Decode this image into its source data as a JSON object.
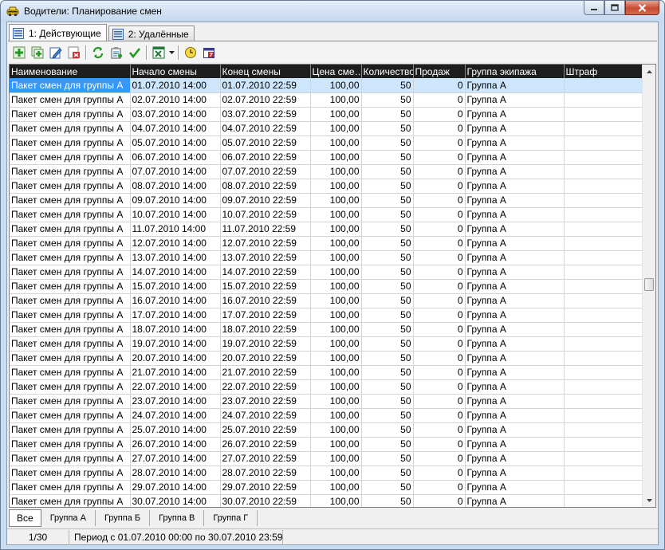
{
  "window": {
    "title": "Водители: Планирование смен"
  },
  "top_tabs": [
    {
      "label": "1: Действующие",
      "active": true
    },
    {
      "label": "2: Удалённые",
      "active": false
    }
  ],
  "toolbar": {
    "buttons": [
      {
        "icon": "add-icon"
      },
      {
        "icon": "add-copy-icon"
      },
      {
        "icon": "edit-icon"
      },
      {
        "icon": "delete-icon"
      },
      {
        "icon": "refresh-icon"
      },
      {
        "icon": "properties-icon"
      },
      {
        "icon": "checkmark-icon"
      },
      {
        "icon": "excel-export-icon"
      },
      {
        "icon": "clock-icon"
      },
      {
        "icon": "calendar-icon"
      }
    ]
  },
  "table": {
    "columns": [
      "Наименование",
      "Начало смены",
      "Конец смены",
      "Цена сме…",
      "Количество",
      "Продаж",
      "Группа экипажа",
      "Штраф"
    ],
    "rows": [
      [
        "Пакет смен для группы А",
        "01.07.2010 14:00",
        "01.07.2010 22:59",
        "100,00",
        "50",
        "0",
        "Группа А",
        ""
      ],
      [
        "Пакет смен для группы А",
        "02.07.2010 14:00",
        "02.07.2010 22:59",
        "100,00",
        "50",
        "0",
        "Группа А",
        ""
      ],
      [
        "Пакет смен для группы А",
        "03.07.2010 14:00",
        "03.07.2010 22:59",
        "100,00",
        "50",
        "0",
        "Группа А",
        ""
      ],
      [
        "Пакет смен для группы А",
        "04.07.2010 14:00",
        "04.07.2010 22:59",
        "100,00",
        "50",
        "0",
        "Группа А",
        ""
      ],
      [
        "Пакет смен для группы А",
        "05.07.2010 14:00",
        "05.07.2010 22:59",
        "100,00",
        "50",
        "0",
        "Группа А",
        ""
      ],
      [
        "Пакет смен для группы А",
        "06.07.2010 14:00",
        "06.07.2010 22:59",
        "100,00",
        "50",
        "0",
        "Группа А",
        ""
      ],
      [
        "Пакет смен для группы А",
        "07.07.2010 14:00",
        "07.07.2010 22:59",
        "100,00",
        "50",
        "0",
        "Группа А",
        ""
      ],
      [
        "Пакет смен для группы А",
        "08.07.2010 14:00",
        "08.07.2010 22:59",
        "100,00",
        "50",
        "0",
        "Группа А",
        ""
      ],
      [
        "Пакет смен для группы А",
        "09.07.2010 14:00",
        "09.07.2010 22:59",
        "100,00",
        "50",
        "0",
        "Группа А",
        ""
      ],
      [
        "Пакет смен для группы А",
        "10.07.2010 14:00",
        "10.07.2010 22:59",
        "100,00",
        "50",
        "0",
        "Группа А",
        ""
      ],
      [
        "Пакет смен для группы А",
        "11.07.2010 14:00",
        "11.07.2010 22:59",
        "100,00",
        "50",
        "0",
        "Группа А",
        ""
      ],
      [
        "Пакет смен для группы А",
        "12.07.2010 14:00",
        "12.07.2010 22:59",
        "100,00",
        "50",
        "0",
        "Группа А",
        ""
      ],
      [
        "Пакет смен для группы А",
        "13.07.2010 14:00",
        "13.07.2010 22:59",
        "100,00",
        "50",
        "0",
        "Группа А",
        ""
      ],
      [
        "Пакет смен для группы А",
        "14.07.2010 14:00",
        "14.07.2010 22:59",
        "100,00",
        "50",
        "0",
        "Группа А",
        ""
      ],
      [
        "Пакет смен для группы А",
        "15.07.2010 14:00",
        "15.07.2010 22:59",
        "100,00",
        "50",
        "0",
        "Группа А",
        ""
      ],
      [
        "Пакет смен для группы А",
        "16.07.2010 14:00",
        "16.07.2010 22:59",
        "100,00",
        "50",
        "0",
        "Группа А",
        ""
      ],
      [
        "Пакет смен для группы А",
        "17.07.2010 14:00",
        "17.07.2010 22:59",
        "100,00",
        "50",
        "0",
        "Группа А",
        ""
      ],
      [
        "Пакет смен для группы А",
        "18.07.2010 14:00",
        "18.07.2010 22:59",
        "100,00",
        "50",
        "0",
        "Группа А",
        ""
      ],
      [
        "Пакет смен для группы А",
        "19.07.2010 14:00",
        "19.07.2010 22:59",
        "100,00",
        "50",
        "0",
        "Группа А",
        ""
      ],
      [
        "Пакет смен для группы А",
        "20.07.2010 14:00",
        "20.07.2010 22:59",
        "100,00",
        "50",
        "0",
        "Группа А",
        ""
      ],
      [
        "Пакет смен для группы А",
        "21.07.2010 14:00",
        "21.07.2010 22:59",
        "100,00",
        "50",
        "0",
        "Группа А",
        ""
      ],
      [
        "Пакет смен для группы А",
        "22.07.2010 14:00",
        "22.07.2010 22:59",
        "100,00",
        "50",
        "0",
        "Группа А",
        ""
      ],
      [
        "Пакет смен для группы А",
        "23.07.2010 14:00",
        "23.07.2010 22:59",
        "100,00",
        "50",
        "0",
        "Группа А",
        ""
      ],
      [
        "Пакет смен для группы А",
        "24.07.2010 14:00",
        "24.07.2010 22:59",
        "100,00",
        "50",
        "0",
        "Группа А",
        ""
      ],
      [
        "Пакет смен для группы А",
        "25.07.2010 14:00",
        "25.07.2010 22:59",
        "100,00",
        "50",
        "0",
        "Группа А",
        ""
      ],
      [
        "Пакет смен для группы А",
        "26.07.2010 14:00",
        "26.07.2010 22:59",
        "100,00",
        "50",
        "0",
        "Группа А",
        ""
      ],
      [
        "Пакет смен для группы А",
        "27.07.2010 14:00",
        "27.07.2010 22:59",
        "100,00",
        "50",
        "0",
        "Группа А",
        ""
      ],
      [
        "Пакет смен для группы А",
        "28.07.2010 14:00",
        "28.07.2010 22:59",
        "100,00",
        "50",
        "0",
        "Группа А",
        ""
      ],
      [
        "Пакет смен для группы А",
        "29.07.2010 14:00",
        "29.07.2010 22:59",
        "100,00",
        "50",
        "0",
        "Группа А",
        ""
      ],
      [
        "Пакет смен для группы А",
        "30.07.2010 14:00",
        "30.07.2010 22:59",
        "100,00",
        "50",
        "0",
        "Группа А",
        ""
      ]
    ],
    "selected_row": 0
  },
  "bottom_tabs": [
    {
      "label": "Все",
      "active": true
    },
    {
      "label": "Группа А",
      "active": false
    },
    {
      "label": "Группа Б",
      "active": false
    },
    {
      "label": "Группа В",
      "active": false
    },
    {
      "label": "Группа Г",
      "active": false
    }
  ],
  "status": {
    "record_count": "1/30",
    "period": "Период с 01.07.2010 00:00 по 30.07.2010 23:59"
  },
  "colors": {
    "header_bg": "#1e1e1e",
    "selection": "#cde6fb",
    "selection_cell": "#3399ff"
  }
}
